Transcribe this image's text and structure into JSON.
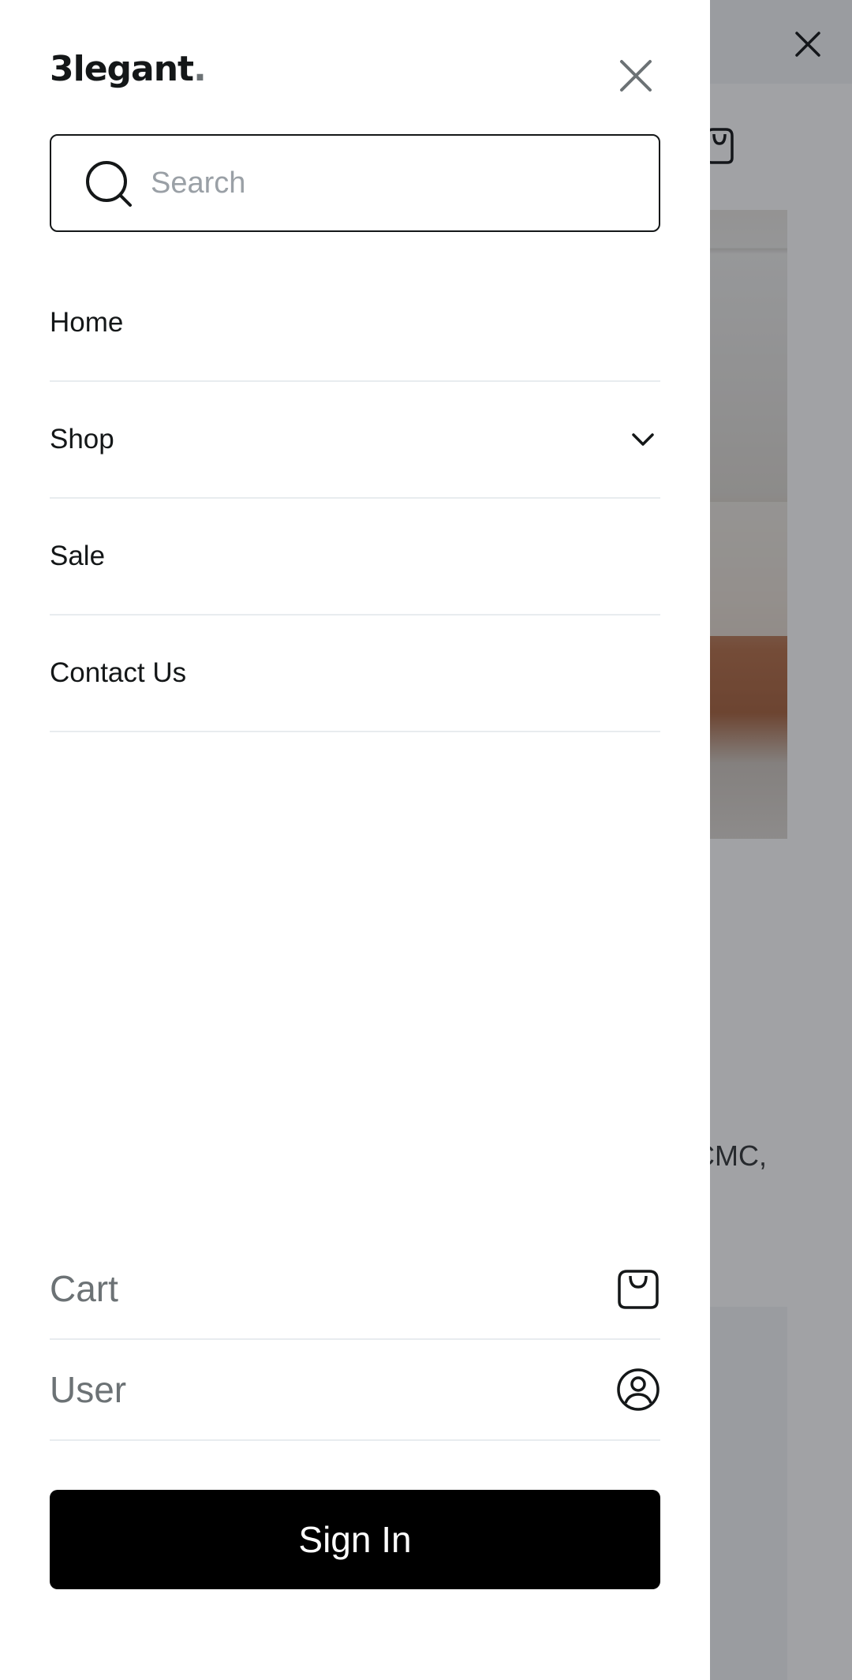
{
  "brand": {
    "logo_text": "3legant",
    "logo_dot": "."
  },
  "search": {
    "placeholder": "Search",
    "value": ""
  },
  "nav": {
    "items": [
      {
        "label": "Home"
      },
      {
        "label": "Shop",
        "has_dropdown": true
      },
      {
        "label": "Sale"
      },
      {
        "label": "Contact Us"
      }
    ]
  },
  "account": {
    "cart_label": "Cart",
    "user_label": "User"
  },
  "actions": {
    "sign_in_label": "Sign In"
  },
  "background_page": {
    "visible_text": "CMC,"
  },
  "icons": {
    "drawer_close": "close-icon",
    "search": "search-icon",
    "dropdown": "chevron-down-icon",
    "cart": "shopping-bag-icon",
    "user": "user-circle-icon",
    "background_close": "close-icon",
    "background_cart": "shopping-bag-icon"
  },
  "colors": {
    "primary": "#141718",
    "muted": "#6c7275",
    "divider": "#e8ecef",
    "button_bg": "#000000",
    "button_text": "#ffffff",
    "overlay": "rgba(20,23,29,0.40)"
  }
}
